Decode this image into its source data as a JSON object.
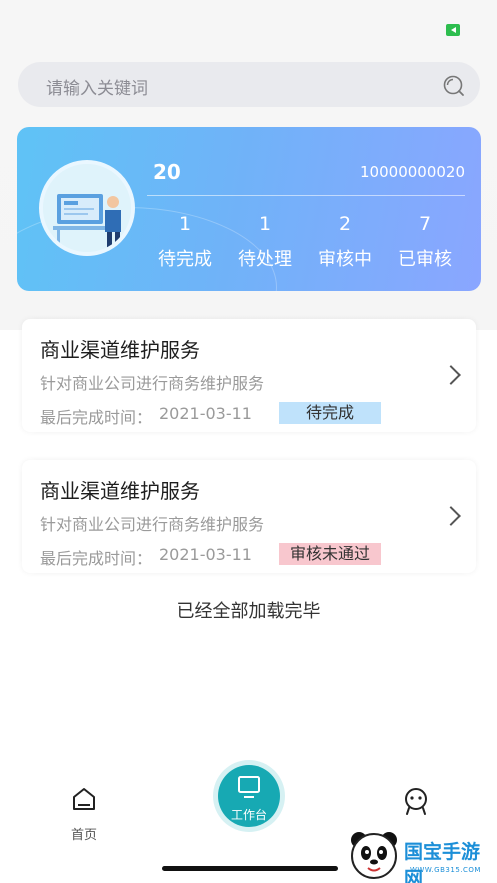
{
  "search": {
    "placeholder": "请输入关键词"
  },
  "profile": {
    "name": "20",
    "id": "10000000020",
    "stats": [
      {
        "value": "1",
        "label": "待完成"
      },
      {
        "value": "1",
        "label": "待处理"
      },
      {
        "value": "2",
        "label": "审核中"
      },
      {
        "value": "7",
        "label": "已审核"
      }
    ]
  },
  "tasks": [
    {
      "title": "商业渠道维护服务",
      "desc": "针对商业公司进行商务维护服务",
      "time_label": "最后完成时间：",
      "time": "2021-03-11",
      "status": "待完成",
      "status_color": "#bfe2fb"
    },
    {
      "title": "商业渠道维护服务",
      "desc": "针对商业公司进行商务维护服务",
      "time_label": "最后完成时间：",
      "time": "2021-03-11",
      "status": "审核未通过",
      "status_color": "#f8c7ce"
    }
  ],
  "list_footer": "已经全部加载完毕",
  "tabbar": {
    "home": "首页",
    "workbench": "工作台"
  },
  "watermark": {
    "text": "国宝手游网",
    "url": "WWW.GB315.COM"
  },
  "colors": {
    "accent": "#17a9b3",
    "card_gradient_start": "#5fc3f6",
    "card_gradient_end": "#8aa6ff"
  }
}
